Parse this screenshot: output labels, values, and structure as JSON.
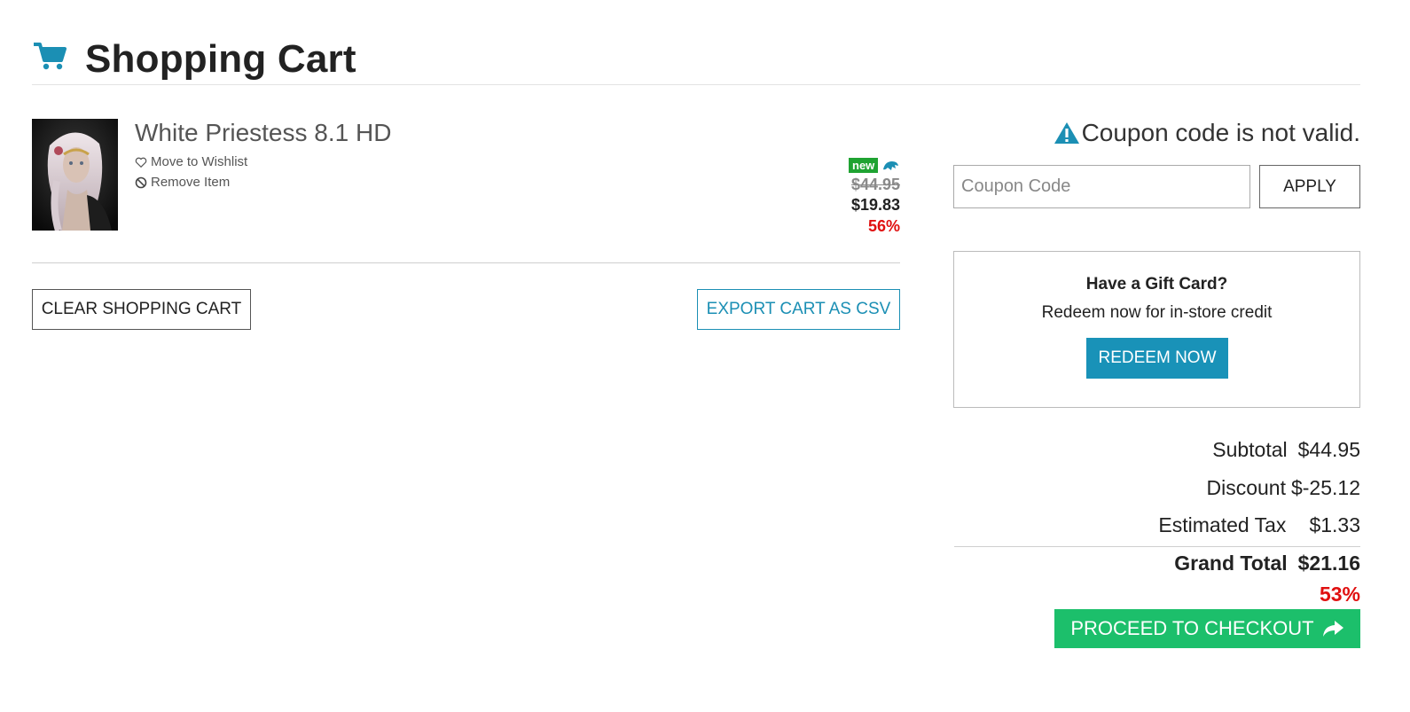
{
  "header": {
    "title": "Shopping Cart",
    "icon": "shopping-cart-icon",
    "accent_color": "#1b8fb4"
  },
  "cart": {
    "items": [
      {
        "name": "White Priestess 8.1 HD",
        "wishlist_label": "Move to Wishlist",
        "remove_label": "Remove Item",
        "badge": "new",
        "old_price": "$44.95",
        "price": "$19.83",
        "discount": "56%"
      }
    ],
    "clear_label": "CLEAR SHOPPING CART",
    "export_label": "EXPORT CART AS CSV"
  },
  "coupon": {
    "error_message": "Coupon code is not valid.",
    "placeholder": "Coupon Code",
    "value": "",
    "apply_label": "APPLY"
  },
  "giftcard": {
    "title": "Have a Gift Card?",
    "subtitle": "Redeem now for in-store credit",
    "button_label": "REDEEM NOW"
  },
  "summary": {
    "subtotal_label": "Subtotal",
    "subtotal_value": "$44.95",
    "discount_label": "Discount",
    "discount_value": "$-25.12",
    "tax_label": "Estimated Tax",
    "tax_value": "$1.33",
    "total_label": "Grand Total",
    "total_value": "$21.16",
    "total_discount": "53%",
    "checkout_label": "PROCEED TO CHECKOUT"
  },
  "colors": {
    "new_badge": "#1fa332",
    "discount_red": "#e01010",
    "redeem_blue": "#1992b8",
    "checkout_green": "#1cbf6b"
  }
}
